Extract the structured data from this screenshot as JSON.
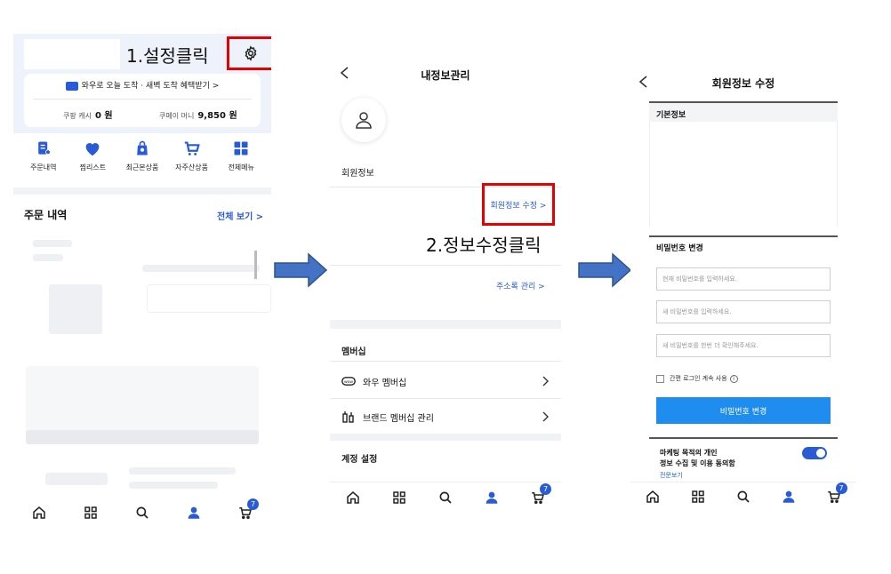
{
  "screen1": {
    "instruction": "1.설정클릭",
    "wow_banner": "와우로 오늘 도착 · 새벽 도착 혜택받기 >",
    "coupang_cash_label": "쿠팡 캐시",
    "coupang_cash_value": "0 원",
    "coupay_money_label": "쿠페이 머니",
    "coupay_money_value": "9,850 원",
    "shortcuts": [
      "주문내역",
      "찜리스트",
      "최근본상품",
      "자주산상품",
      "전체메뉴"
    ],
    "order_title": "주문 내역",
    "order_view_all": "전체 보기 >"
  },
  "screen2": {
    "title": "내정보관리",
    "member_info_label": "회원정보",
    "edit_member_link": "회원정보 수정 >",
    "instruction": "2.정보수정클릭",
    "address_link": "주소록 관리 >",
    "membership_title": "멤버십",
    "wow_membership": "와우 멤버십",
    "brand_membership": "브랜드 멤버십 관리",
    "account_settings": "계정 설정"
  },
  "screen3": {
    "title": "회원정보 수정",
    "basic_info": "기본정보",
    "password_change_title": "비밀번호 변경",
    "current_pw_placeholder": "현재 비밀번호를 입력하세요.",
    "new_pw_placeholder": "새 비밀번호를 입력하세요.",
    "confirm_pw_placeholder": "새 비밀번호를 한번 더 확인해주세요.",
    "keep_login": "간편 로그인 계속 사용",
    "change_pw_button": "비밀번호 변경",
    "marketing_line1": "마케팅 목적의 개인",
    "marketing_line2": "정보 수집 및 이용 동의함",
    "full_text": "전문보기"
  },
  "nav": {
    "cart_count": "7"
  },
  "colors": {
    "accent": "#2a5bd7",
    "highlight": "#e60000",
    "button": "#1f8cf0",
    "arrow": "#4472c4"
  }
}
